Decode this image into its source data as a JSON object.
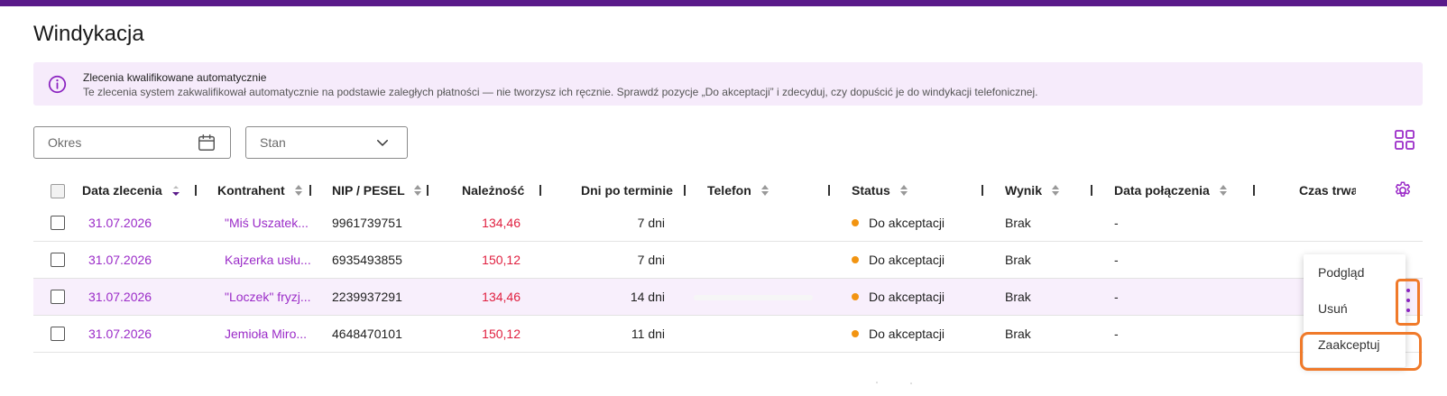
{
  "page": {
    "title": "Windykacja"
  },
  "banner": {
    "title": "Zlecenia kwalifikowane automatycznie",
    "text": "Te zlecenia system zakwalifikował automatycznie na podstawie zaległych płatności — nie tworzysz ich ręcznie. Sprawdź pozycje „Do akceptacji” i zdecyduj, czy dopuścić je do windykacji telefonicznej."
  },
  "filters": {
    "period_placeholder": "Okres",
    "state_placeholder": "Stan"
  },
  "table": {
    "columns": {
      "date": "Data zlecenia",
      "contractor": "Kontrahent",
      "nip": "NIP / PESEL",
      "amount": "Należność",
      "days": "Dni po terminie",
      "phone": "Telefon",
      "status": "Status",
      "result": "Wynik",
      "call_date": "Data połączenia",
      "duration": "Czas trwa"
    },
    "rows": [
      {
        "date": "31.07.2026",
        "contractor": "\"Miś Uszatek...",
        "nip": "9961739751",
        "amount": "134,46",
        "days": "7 dni",
        "phone": "",
        "status": "Do akceptacji",
        "result": "Brak",
        "call_date": "-"
      },
      {
        "date": "31.07.2026",
        "contractor": "Kajzerka usłu...",
        "nip": "6935493855",
        "amount": "150,12",
        "days": "7 dni",
        "phone": "",
        "status": "Do akceptacji",
        "result": "Brak",
        "call_date": "-"
      },
      {
        "date": "31.07.2026",
        "contractor": "\"Loczek\" fryzj...",
        "nip": "2239937291",
        "amount": "134,46",
        "days": "14 dni",
        "phone": "",
        "status": "Do akceptacji",
        "result": "Brak",
        "call_date": "-"
      },
      {
        "date": "31.07.2026",
        "contractor": "Jemioła Miro...",
        "nip": "4648470101",
        "amount": "150,12",
        "days": "11 dni",
        "phone": "",
        "status": "Do akceptacji",
        "result": "Brak",
        "call_date": "-"
      }
    ]
  },
  "row_menu": {
    "preview": "Podgląd",
    "delete": "Usuń",
    "accept": "Zaakceptuj"
  },
  "colors": {
    "accent": "#9b2cc8",
    "topbar": "#5a1a8a",
    "amount": "#e02040",
    "status_pending": "#f29411",
    "highlight_outline": "#f07a2a",
    "banner_bg": "#f6ebfb"
  }
}
